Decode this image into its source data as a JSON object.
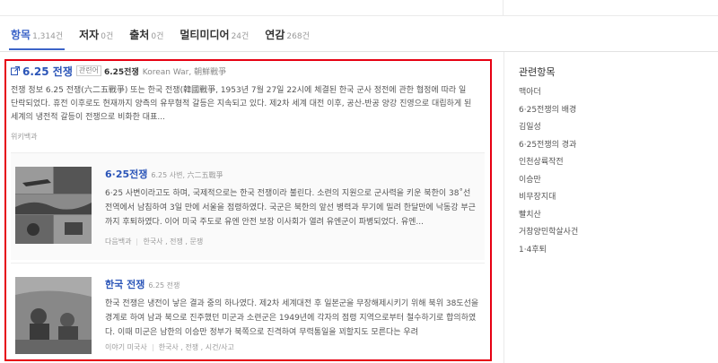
{
  "tabs": [
    {
      "label": "항목",
      "count": "1,314건",
      "active": true
    },
    {
      "label": "저자",
      "count": "0건",
      "active": false
    },
    {
      "label": "출처",
      "count": "0건",
      "active": false
    },
    {
      "label": "멀티미디어",
      "count": "24건",
      "active": false
    },
    {
      "label": "연감",
      "count": "268건",
      "active": false
    }
  ],
  "results": {
    "first": {
      "title": "6.25 전쟁",
      "alias_badge": "관련어",
      "alias_term": "6.25전쟁",
      "alias_foreign": "Korean War, 朝鮮戰爭",
      "snippet": "전쟁 정보 6.25 전쟁(六二五戰爭) 또는 한국 전쟁(韓國戰爭, 1953년 7월 27일 22시에 체결된 한국 군사 정전에 관한 협정에 따라 일단락되었다. 휴전 이후로도 현재까지 양측의 유무형적 갈등은 지속되고 있다. 제2차 세계 대전 이후, 공산-반공 양강 진영으로 대립하게 된 세계의 냉전적 갈등이 전쟁으로 비화한 대표...",
      "source": "위키백과"
    },
    "second": {
      "title": "6·25전쟁",
      "alias": "6.25 사변, 六二五戰爭",
      "snippet": "6·25 사변이라고도 하며, 국제적으로는 한국 전쟁이라 불린다. 소련의 지원으로 군사력을 키운 북한이 38˚선 전역에서 남침하여 3일 만에 서울을 점령하였다. 국군은 북한의 앞선 병력과 무기에 밀려 한달만에 낙동강 부근까지 후퇴하였다. 이어 미국 주도로 유엔 안전 보장 이사회가 열려 유엔군이 파병되었다. 유엔...",
      "meta": [
        "다음백과",
        "한국사 , 전쟁 , 문쟁"
      ]
    },
    "third": {
      "title": "한국 전쟁",
      "alias": "6.25 전쟁",
      "snippet": "한국 전쟁은 냉전이 낳은 결과 중의 하나였다. 제2차 세계대전 후 일본군을 무장해제시키기 위해 북위 38도선을 경계로 하여 남과 북으로 진주했던 미군과 소련군은 1949년에 각자의 점령 지역으로부터 철수하기로 합의하였다. 이때 미군은 남한의 이승만 정부가 북쪽으로 진격하여 무력통일을 꾀할지도 모른다는 우려",
      "meta": [
        "이야기 미국사",
        "한국사 , 전쟁 , 시건/사고"
      ]
    }
  },
  "sidebar": {
    "title": "관련항목",
    "items": [
      "맥아더",
      "6·25전쟁의 배경",
      "김일성",
      "6·25전쟁의 경과",
      "인천상륙작전",
      "이승만",
      "비무장지대",
      "빨치산",
      "거창양민학살사건",
      "1·4후퇴"
    ]
  },
  "colors": {
    "accent": "#3c64c8",
    "link": "#2b55b8",
    "highlight_border": "#e60012"
  },
  "icons": {
    "external_link": "external-link-icon"
  }
}
